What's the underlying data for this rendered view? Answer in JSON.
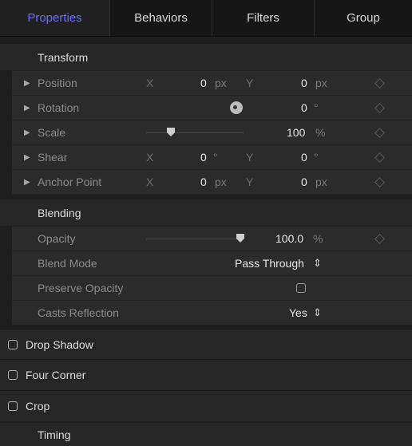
{
  "tabs": [
    "Properties",
    "Behaviors",
    "Filters",
    "Group"
  ],
  "transform": {
    "title": "Transform",
    "position": {
      "label": "Position",
      "x_axis": "X",
      "x_value": "0",
      "x_unit": "px",
      "y_axis": "Y",
      "y_value": "0",
      "y_unit": "px"
    },
    "rotation": {
      "label": "Rotation",
      "value": "0",
      "unit": "°"
    },
    "scale": {
      "label": "Scale",
      "value": "100",
      "unit": "%"
    },
    "shear": {
      "label": "Shear",
      "x_axis": "X",
      "x_value": "0",
      "x_unit": "°",
      "y_axis": "Y",
      "y_value": "0",
      "y_unit": "°"
    },
    "anchor": {
      "label": "Anchor Point",
      "x_axis": "X",
      "x_value": "0",
      "x_unit": "px",
      "y_axis": "Y",
      "y_value": "0",
      "y_unit": "px"
    }
  },
  "blending": {
    "title": "Blending",
    "opacity": {
      "label": "Opacity",
      "value": "100.0",
      "unit": "%"
    },
    "blend_mode": {
      "label": "Blend Mode",
      "value": "Pass Through"
    },
    "preserve_opacity": {
      "label": "Preserve Opacity",
      "checked": false
    },
    "casts_reflection": {
      "label": "Casts Reflection",
      "value": "Yes"
    }
  },
  "groups": {
    "drop_shadow": "Drop Shadow",
    "four_corner": "Four Corner",
    "crop": "Crop",
    "timing": "Timing"
  },
  "icons": {
    "disclosure": "triangle-right-icon",
    "keyframe": "diamond-icon",
    "stepper": "up-down-chevron-icon"
  },
  "colors": {
    "accent": "#6d6cff",
    "background": "#1e1e1e"
  }
}
